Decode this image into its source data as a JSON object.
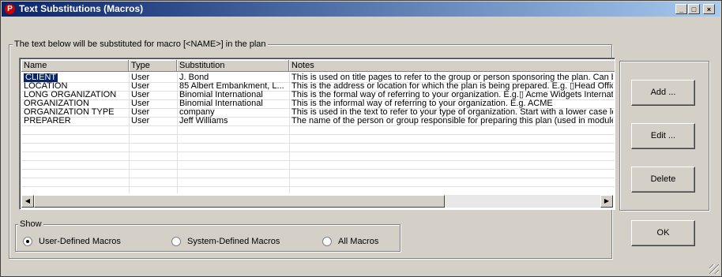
{
  "window": {
    "title": "Text Substitutions (Macros)",
    "icon": "P",
    "controls": [
      "_",
      "□",
      "×"
    ]
  },
  "group_main": {
    "label": "The text below will be substituted for macro [<NAME>] in the plan"
  },
  "table": {
    "columns": [
      "Name",
      "Type",
      "Substitution",
      "Notes"
    ],
    "rows": [
      [
        "CLIENT",
        "User",
        "J. Bond",
        "This is used on title pages to refer to the group or person sponsoring the plan. Can b"
      ],
      [
        "LOCATION",
        "User",
        "85 Albert Embankment, L...",
        "This is the address or location for which the plan is being prepared. E.g. ▯Head Offic"
      ],
      [
        "LONG ORGANIZATION",
        "User",
        "Binomial International",
        "This is the formal way of referring to your organization. E.g.▯ Acme Widgets Internati"
      ],
      [
        "ORGANIZATION",
        "User",
        "Binomial International",
        "This is the informal way of referring to your organization. E.g. ACME"
      ],
      [
        "ORGANIZATION TYPE",
        "User",
        "company",
        "This is used in the text to refer to your type of organization. Start with a lower case le"
      ],
      [
        "PREPARER",
        "User",
        "Jeff Williams",
        "The name of the person or group responsible for preparing this plan (used in module"
      ]
    ],
    "selected_row": 0
  },
  "show": {
    "label": "Show",
    "options": [
      "User-Defined Macros",
      "System-Defined Macros",
      "All Macros"
    ],
    "selected": 0
  },
  "buttons": {
    "add": "Add ...",
    "edit": "Edit ...",
    "delete": "Delete",
    "ok": "OK"
  },
  "colors": {
    "titlebar_start": "#0a246a",
    "titlebar_end": "#a6caf0",
    "selection": "#0a246a",
    "face": "#d4d0c8"
  }
}
